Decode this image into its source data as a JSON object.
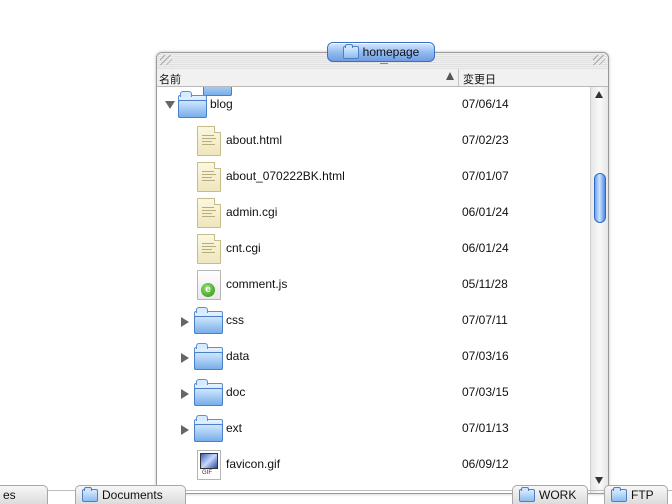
{
  "window": {
    "title": "homepage",
    "columns": {
      "name": "名前",
      "date": "変更日"
    }
  },
  "rows": [
    {
      "name": "blog",
      "date": "07/06/14",
      "kind": "folder",
      "disclosure": "open",
      "level": 0
    },
    {
      "name": "about.html",
      "date": "07/02/23",
      "kind": "doc",
      "level": 1
    },
    {
      "name": "about_070222BK.html",
      "date": "07/01/07",
      "kind": "doc",
      "level": 1
    },
    {
      "name": "admin.cgi",
      "date": "06/01/24",
      "kind": "doc",
      "level": 1
    },
    {
      "name": "cnt.cgi",
      "date": "06/01/24",
      "kind": "doc",
      "level": 1
    },
    {
      "name": "comment.js",
      "date": "05/11/28",
      "kind": "js",
      "level": 1
    },
    {
      "name": "css",
      "date": "07/07/11",
      "kind": "folder",
      "disclosure": "closed",
      "level": 1
    },
    {
      "name": "data",
      "date": "07/03/16",
      "kind": "folder",
      "disclosure": "closed",
      "level": 1
    },
    {
      "name": "doc",
      "date": "07/03/15",
      "kind": "folder",
      "disclosure": "closed",
      "level": 1
    },
    {
      "name": "ext",
      "date": "07/01/13",
      "kind": "folder",
      "disclosure": "closed",
      "level": 1
    },
    {
      "name": "favicon.gif",
      "date": "06/09/12",
      "kind": "gif",
      "level": 1
    }
  ],
  "icons": {
    "gif_label": "GIF",
    "js_badge": "e"
  },
  "dock": {
    "left_partial": "es",
    "documents": "Documents",
    "work": "WORK",
    "ftp": "FTP"
  },
  "colors": {
    "accent": "#6f9de0",
    "thumb": "#4d8be4"
  }
}
